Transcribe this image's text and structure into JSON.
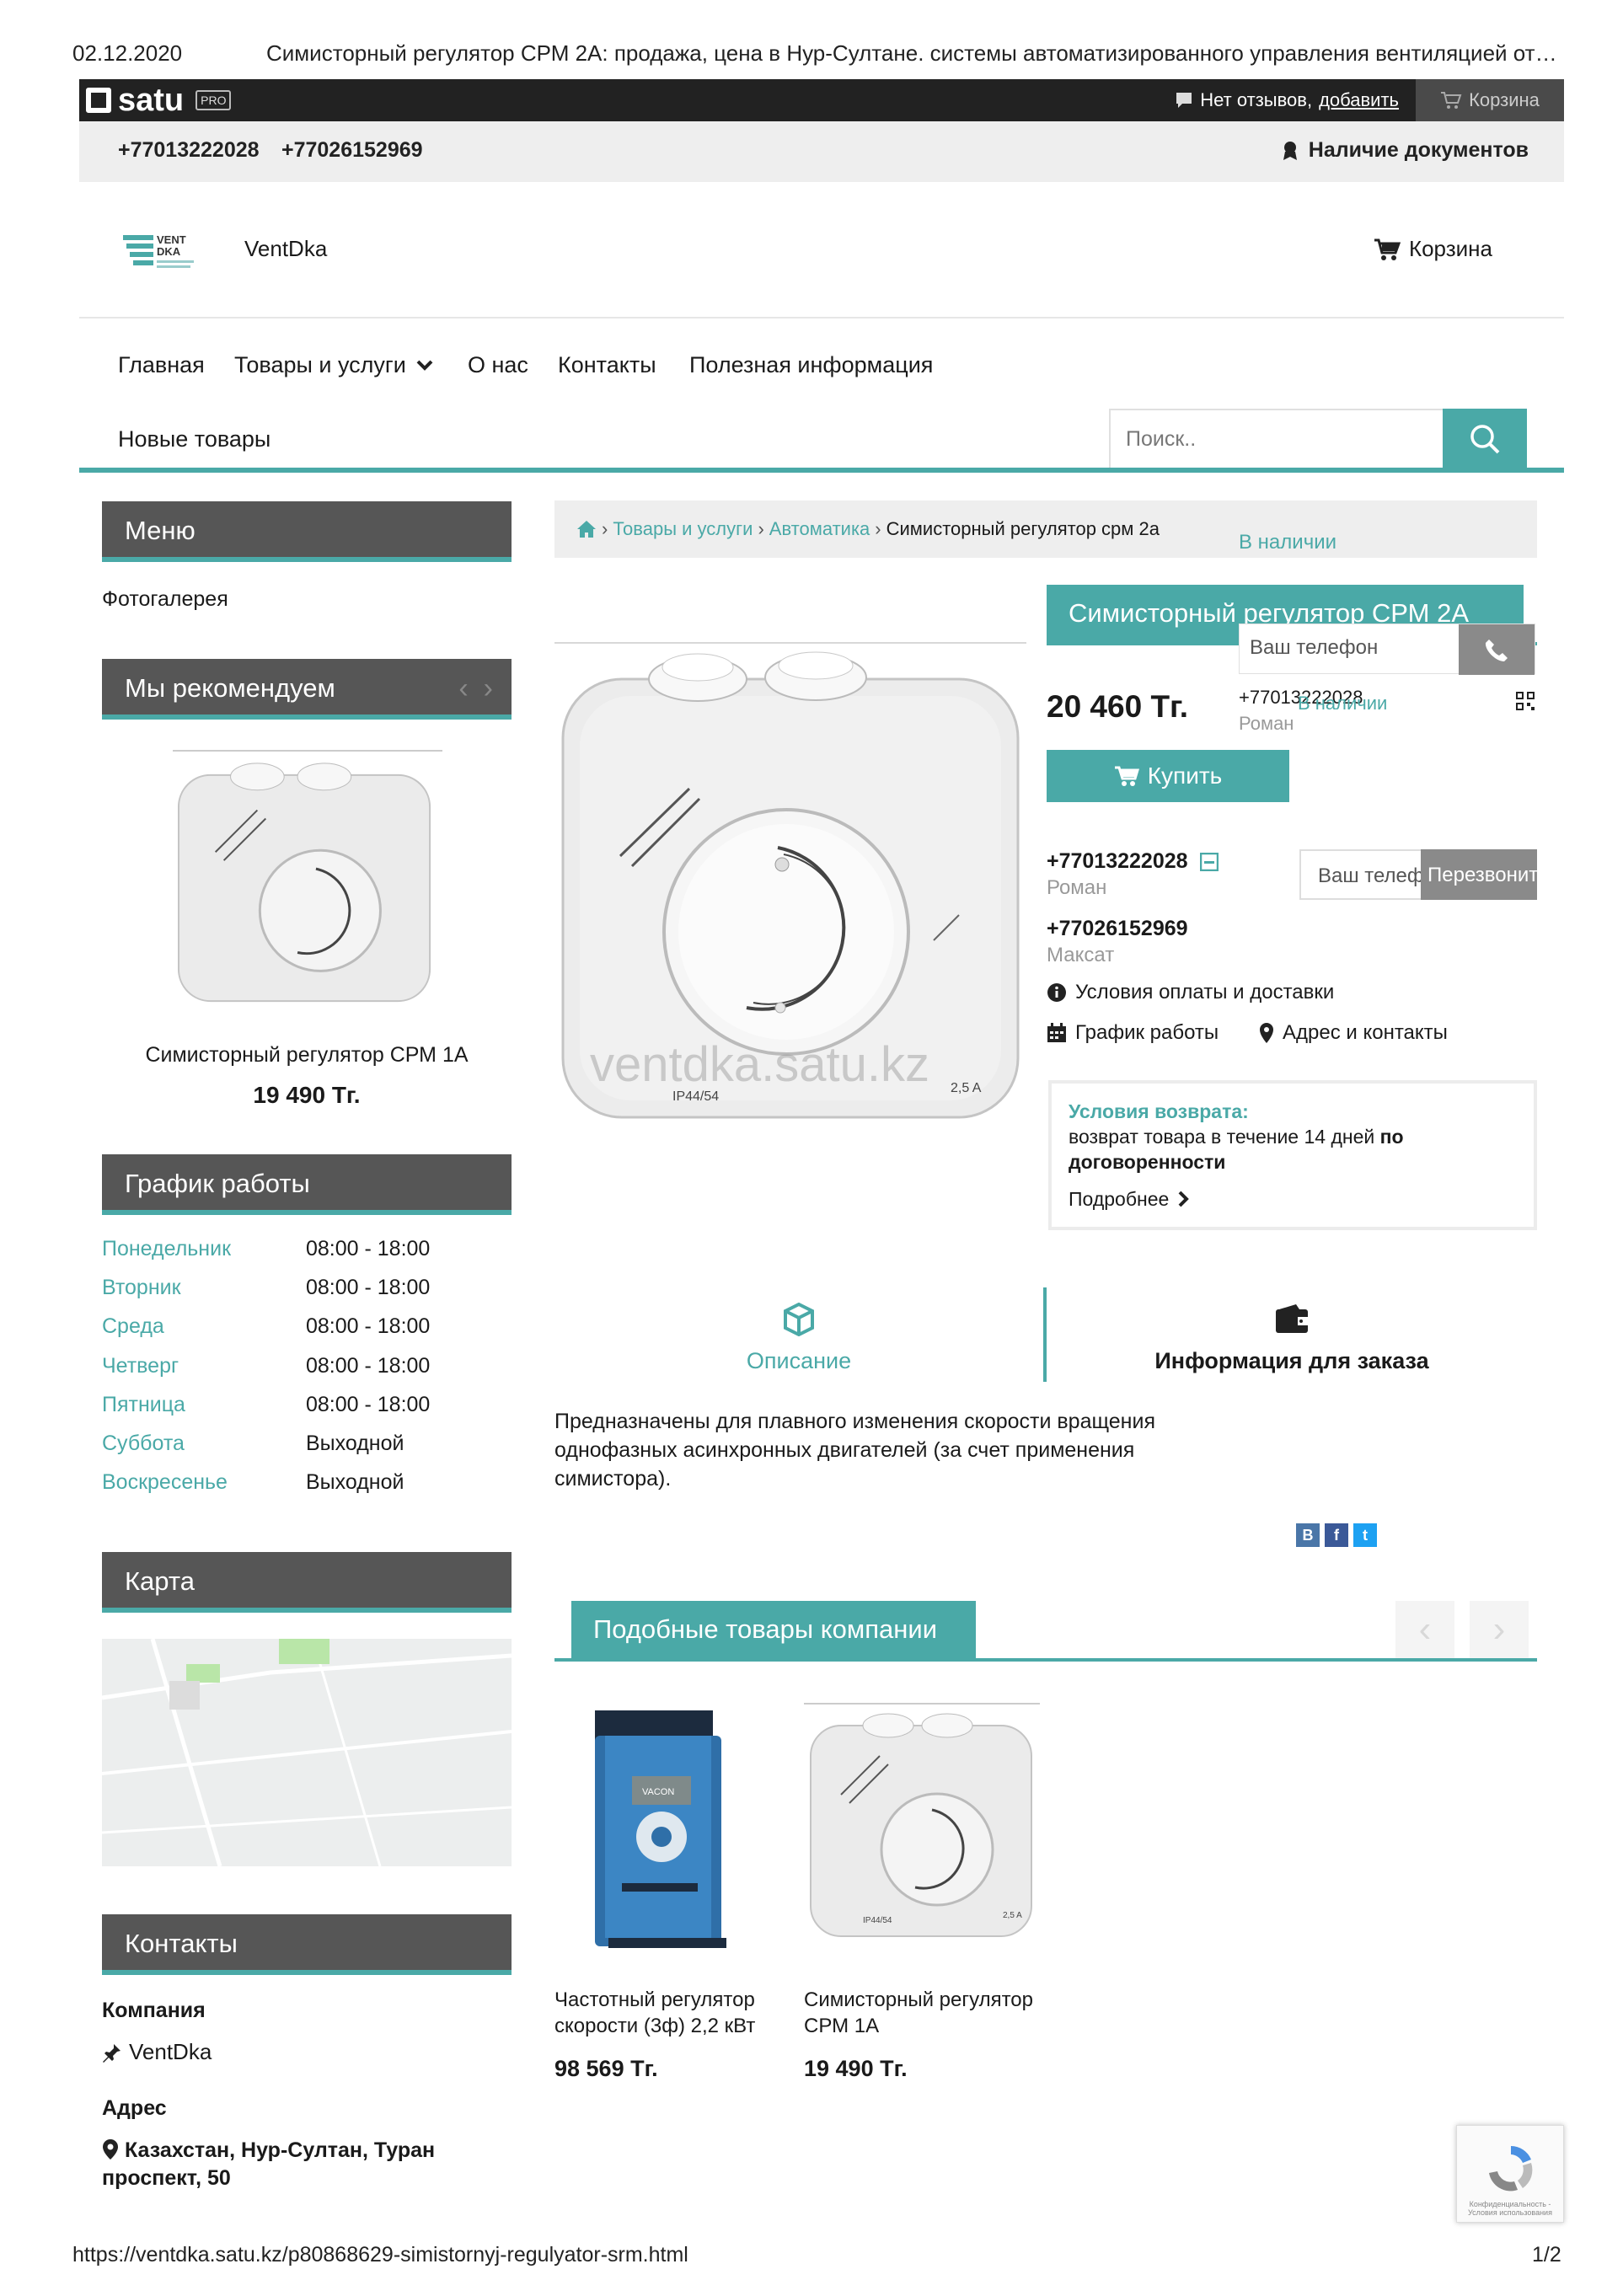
{
  "print": {
    "date": "02.12.2020",
    "title": "Симисторный регулятор СРМ 2А: продажа, цена в Нур-Султане. системы автоматизированного управления вентиляцией от…",
    "url": "https://ventdka.satu.kz/p80868629-simistornyj-regulyator-srm.html",
    "page": "1/2"
  },
  "satu_bar": {
    "logo": "satu",
    "badge": "PRO",
    "reviews_text": "Нет отзывов,",
    "reviews_add": "добавить",
    "cart": "Корзина"
  },
  "contacts_bar": {
    "phone1": "+77013222028",
    "phone2": "+77026152969",
    "documents": "Наличие документов"
  },
  "shop": {
    "name": "VentDka",
    "logo_text": "VENT DKA",
    "cart": "Корзина"
  },
  "nav": {
    "items": [
      "Главная",
      "Товары и услуги",
      "О нас",
      "Контакты",
      "Полезная информация"
    ],
    "new_goods": "Новые товары",
    "search_placeholder": "Поиск.."
  },
  "sidebar": {
    "menu_title": "Меню",
    "photo_gallery": "Фотогалерея",
    "recommend_title": "Мы рекомендуем",
    "recommend_product": "Симисторный регулятор СРМ 1А",
    "recommend_price": "19 490 Тг.",
    "schedule_title": "График работы",
    "schedule": [
      {
        "day": "Понедельник",
        "time": "08:00 - 18:00"
      },
      {
        "day": "Вторник",
        "time": "08:00 - 18:00"
      },
      {
        "day": "Среда",
        "time": "08:00 - 18:00"
      },
      {
        "day": "Четверг",
        "time": "08:00 - 18:00"
      },
      {
        "day": "Пятница",
        "time": "08:00 - 18:00"
      },
      {
        "day": "Суббота",
        "time": "Выходной"
      },
      {
        "day": "Воскресенье",
        "time": "Выходной"
      }
    ],
    "map_title": "Карта",
    "contacts_title": "Контакты",
    "company_label": "Компания",
    "company_name": "VentDka",
    "address_label": "Адрес",
    "address": "Казахстан, Нур-Султан, Туран проспект, 50"
  },
  "breadcrumb": {
    "items": [
      "Товары и услуги",
      "Автоматика"
    ],
    "current": "Симисторный регулятор срм 2а",
    "availability": "В наличии"
  },
  "product": {
    "title": "Симисторный регулятор СРМ 2А",
    "price": "20 460 Тг.",
    "buy": "Купить",
    "watermark": "ventdka.satu.kz",
    "popup": {
      "placeholder": "Ваш телефон",
      "phone": "+77013222028",
      "availability": "В наличии",
      "name": "Роман"
    },
    "contacts": [
      {
        "phone": "+77013222028",
        "name": "Роман"
      },
      {
        "phone": "+77026152969",
        "name": "Максат"
      }
    ],
    "callback_placeholder": "Ваш телефон",
    "callback_button": "Перезвонить",
    "payment_delivery": "Условия оплаты и доставки",
    "schedule_link": "График работы",
    "address_link": "Адрес и контакты",
    "return": {
      "title": "Условия возврата:",
      "text_plain": "возврат товара в течение 14 дней ",
      "text_bold": "по договоренности",
      "more": "Подробнее"
    }
  },
  "tabs": {
    "description": "Описание",
    "order_info": "Информация для заказа"
  },
  "description": "Предназначены для плавного изменения скорости вращения однофазных асинхронных двигателей (за счет применения симистора).",
  "share": [
    "B",
    "f",
    "t"
  ],
  "similar": {
    "title": "Подобные товары компании",
    "items": [
      {
        "title": "Частотный регулятор скорости (3ф) 2,2 кВт",
        "price": "98 569 Тг."
      },
      {
        "title": "Симисторный регулятор СРМ 1А",
        "price": "19 490 Тг."
      }
    ]
  },
  "recaptcha": "Конфиденциальность - Условия использования",
  "colors": {
    "accent": "#4aa9a7",
    "dark": "#565656",
    "topbar": "#222222"
  }
}
